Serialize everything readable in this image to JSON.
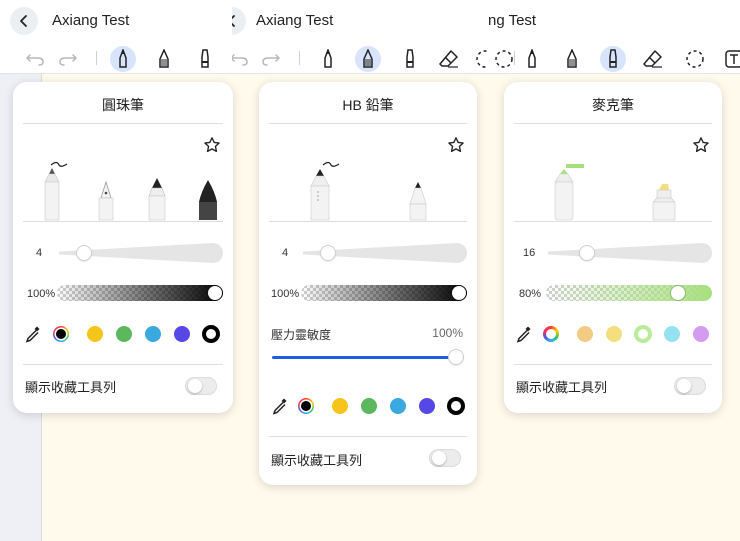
{
  "app": {
    "doc_title": "Axiang Test",
    "doc_title_clipped": "ng Test"
  },
  "panels": {
    "ballpoint": {
      "title": "圓珠筆",
      "size_value": "4",
      "size_level": 0.15,
      "opacity_value": "100%",
      "opacity_level": 1.0,
      "stroke_color": "#000000",
      "favorite_label": "顯示收藏工具列",
      "favorite_on": false,
      "colors": [
        "#f5c51b",
        "#5bb85d",
        "#3aa9e0",
        "#5747e6",
        "#000000"
      ],
      "selected_color": "#000000"
    },
    "hb_pencil": {
      "title": "HB 鉛筆",
      "size_value": "4",
      "size_level": 0.15,
      "opacity_value": "100%",
      "opacity_level": 1.0,
      "pressure_label": "壓力靈敏度",
      "pressure_value": "100%",
      "pressure_level": 1.0,
      "stroke_color": "#000000",
      "favorite_label": "顯示收藏工具列",
      "favorite_on": false,
      "colors": [
        "#f5c51b",
        "#5bb85d",
        "#3aa9e0",
        "#5747e6",
        "#000000"
      ],
      "selected_color": "#000000"
    },
    "marker": {
      "title": "麥克筆",
      "size_value": "16",
      "size_level": 0.25,
      "opacity_value": "80%",
      "opacity_level": 0.8,
      "stroke_color": "#a6e07e",
      "favorite_label": "顯示收藏工具列",
      "favorite_on": false,
      "colors": [
        "#f3cc84",
        "#f4de7e",
        "#b8ec9b",
        "#95e1ef",
        "#d49cf0"
      ],
      "selected_color": "#b8ec9b"
    }
  },
  "icons": {
    "back": "back-arrow-icon",
    "undo": "undo-icon",
    "redo": "redo-icon",
    "pen": "pen-icon",
    "pencil": "pencil-icon",
    "marker": "marker-icon",
    "eraser": "eraser-icon",
    "lasso": "lasso-icon",
    "star": "star-icon",
    "eyedropper": "eyedropper-icon",
    "color_wheel": "color-wheel-icon"
  },
  "accent_color": "#1f5ee0"
}
